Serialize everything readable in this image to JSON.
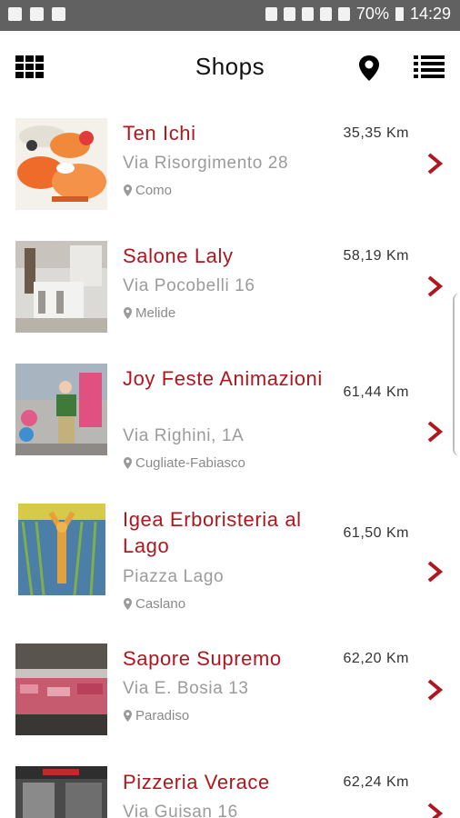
{
  "status_bar": {
    "battery": "70%",
    "time": "14:29"
  },
  "header": {
    "title": "Shops"
  },
  "shops": [
    {
      "name": "Ten Ichi",
      "street": "Via Risorgimento 28",
      "city": "Como",
      "distance": "35,35 Km"
    },
    {
      "name": "Salone Laly",
      "street": "Via Pocobelli 16",
      "city": "Melide",
      "distance": "58,19 Km"
    },
    {
      "name": "Joy Feste Animazioni",
      "street": "Via Righini, 1A",
      "city": "Cugliate-Fabiasco",
      "distance": "61,44 Km"
    },
    {
      "name": "Igea Erboristeria al Lago",
      "street": "Piazza Lago",
      "city": "Caslano",
      "distance": "61,50 Km"
    },
    {
      "name": "Sapore Supremo",
      "street": "Via E. Bosia 13",
      "city": "Paradiso",
      "distance": "62,20 Km"
    },
    {
      "name": "Pizzeria Verace",
      "street": "Via Guisan 16",
      "city": "",
      "distance": "62,24 Km"
    }
  ],
  "colors": {
    "accent": "#b0161e",
    "status_bar": "#616161"
  }
}
